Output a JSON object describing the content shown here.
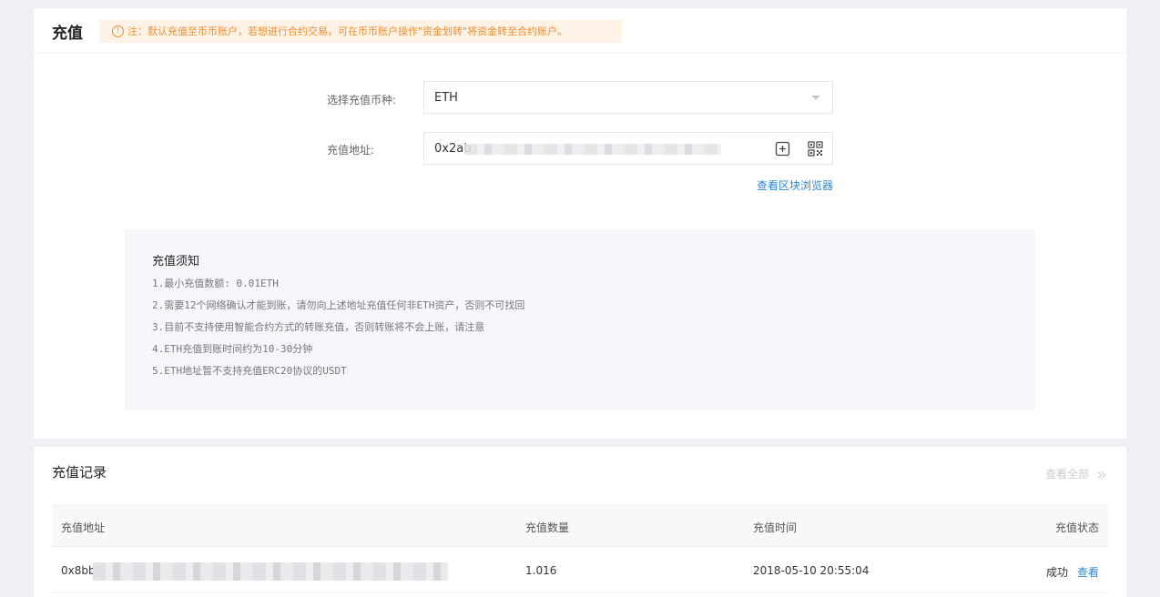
{
  "deposit": {
    "title": "充值",
    "notice": "注：默认充值至币币账户，若想进行合约交易，可在币币账户操作\"资金划转\"将资金转至合约账户。",
    "coin_label": "选择充值币种:",
    "coin_value": "ETH",
    "address_label": "充值地址:",
    "address_prefix": "0x2ab",
    "explorer_link": "查看区块浏览器",
    "notes": {
      "title": "充值须知",
      "items": [
        "1.最小充值数额: 0.01ETH",
        "2.需要12个网络确认才能到账，请勿向上述地址充值任何非ETH资产，否则不可找回",
        "3.目前不支持使用智能合约方式的转账充值，否则转账将不会上账，请注意",
        "4.ETH充值到账时间约为10-30分钟",
        "5.ETH地址暂不支持充值ERC20协议的USDT"
      ]
    }
  },
  "records": {
    "title": "充值记录",
    "view_all": "查看全部",
    "columns": [
      "充值地址",
      "充值数量",
      "充值时间",
      "充值状态"
    ],
    "rows": [
      {
        "address_prefix": "0x8bb",
        "amount": "1.016",
        "time": "2018-05-10 20:55:04",
        "status": "成功",
        "action": "查看"
      }
    ]
  },
  "colors": {
    "accent": "#2f86d6",
    "warning": "#f08c2e",
    "warning_bg": "#fef3e6"
  },
  "icons": [
    "warning-icon",
    "copy-icon",
    "qr-code-icon",
    "chevron-double-right-icon",
    "dropdown-caret-icon"
  ]
}
